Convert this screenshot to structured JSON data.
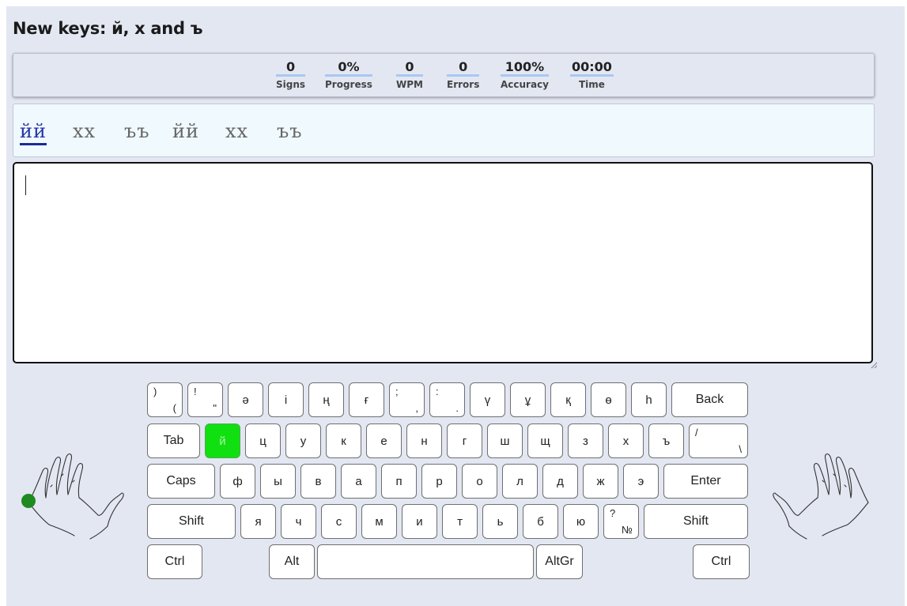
{
  "title": "New keys: й, х and ъ",
  "stats": [
    {
      "value": "0",
      "label": "Signs"
    },
    {
      "value": "0%",
      "label": "Progress"
    },
    {
      "value": "0",
      "label": "WPM"
    },
    {
      "value": "0",
      "label": "Errors"
    },
    {
      "value": "100%",
      "label": "Accuracy"
    },
    {
      "value": "00:00",
      "label": "Time"
    }
  ],
  "words": [
    "йй",
    "хх",
    "ъъ",
    "йй",
    "хх",
    "ъъ"
  ],
  "typing_area": {
    "value": ""
  },
  "keyboard": {
    "row1": [
      {
        "tl": ")",
        "br": "("
      },
      {
        "tl": "!",
        "br": "\""
      },
      {
        "c": "ә"
      },
      {
        "c": "і"
      },
      {
        "c": "ң"
      },
      {
        "c": "ғ"
      },
      {
        "tl": ";",
        "br": ","
      },
      {
        "tl": ":",
        "br": "."
      },
      {
        "c": "ү"
      },
      {
        "c": "ұ"
      },
      {
        "c": "қ"
      },
      {
        "c": "ө"
      },
      {
        "c": "һ"
      },
      {
        "c": "Back"
      }
    ],
    "row2": [
      {
        "c": "Tab"
      },
      {
        "c": "й"
      },
      {
        "c": "ц"
      },
      {
        "c": "у"
      },
      {
        "c": "к"
      },
      {
        "c": "е"
      },
      {
        "c": "н"
      },
      {
        "c": "г"
      },
      {
        "c": "ш"
      },
      {
        "c": "щ"
      },
      {
        "c": "з"
      },
      {
        "c": "х"
      },
      {
        "c": "ъ"
      },
      {
        "tl": "/",
        "br": "\\"
      }
    ],
    "row3": [
      {
        "c": "Caps"
      },
      {
        "c": "ф"
      },
      {
        "c": "ы"
      },
      {
        "c": "в"
      },
      {
        "c": "а"
      },
      {
        "c": "п"
      },
      {
        "c": "р"
      },
      {
        "c": "о"
      },
      {
        "c": "л"
      },
      {
        "c": "д"
      },
      {
        "c": "ж"
      },
      {
        "c": "э"
      },
      {
        "c": "Enter"
      }
    ],
    "row4": [
      {
        "c": "Shift"
      },
      {
        "c": "я"
      },
      {
        "c": "ч"
      },
      {
        "c": "с"
      },
      {
        "c": "м"
      },
      {
        "c": "и"
      },
      {
        "c": "т"
      },
      {
        "c": "ь"
      },
      {
        "c": "б"
      },
      {
        "c": "ю"
      },
      {
        "tl": "?",
        "br": "№"
      },
      {
        "c": "Shift"
      }
    ],
    "row5": [
      {
        "c": "Ctrl"
      },
      {
        "c": "Alt"
      },
      {
        "c": ""
      },
      {
        "c": "AltGr"
      },
      {
        "c": "Ctrl"
      }
    ],
    "active_key": "й",
    "active_color": "#10e010"
  },
  "finger_indicator": {
    "hand": "left",
    "finger": "pinky",
    "color": "#1f8a1f"
  }
}
